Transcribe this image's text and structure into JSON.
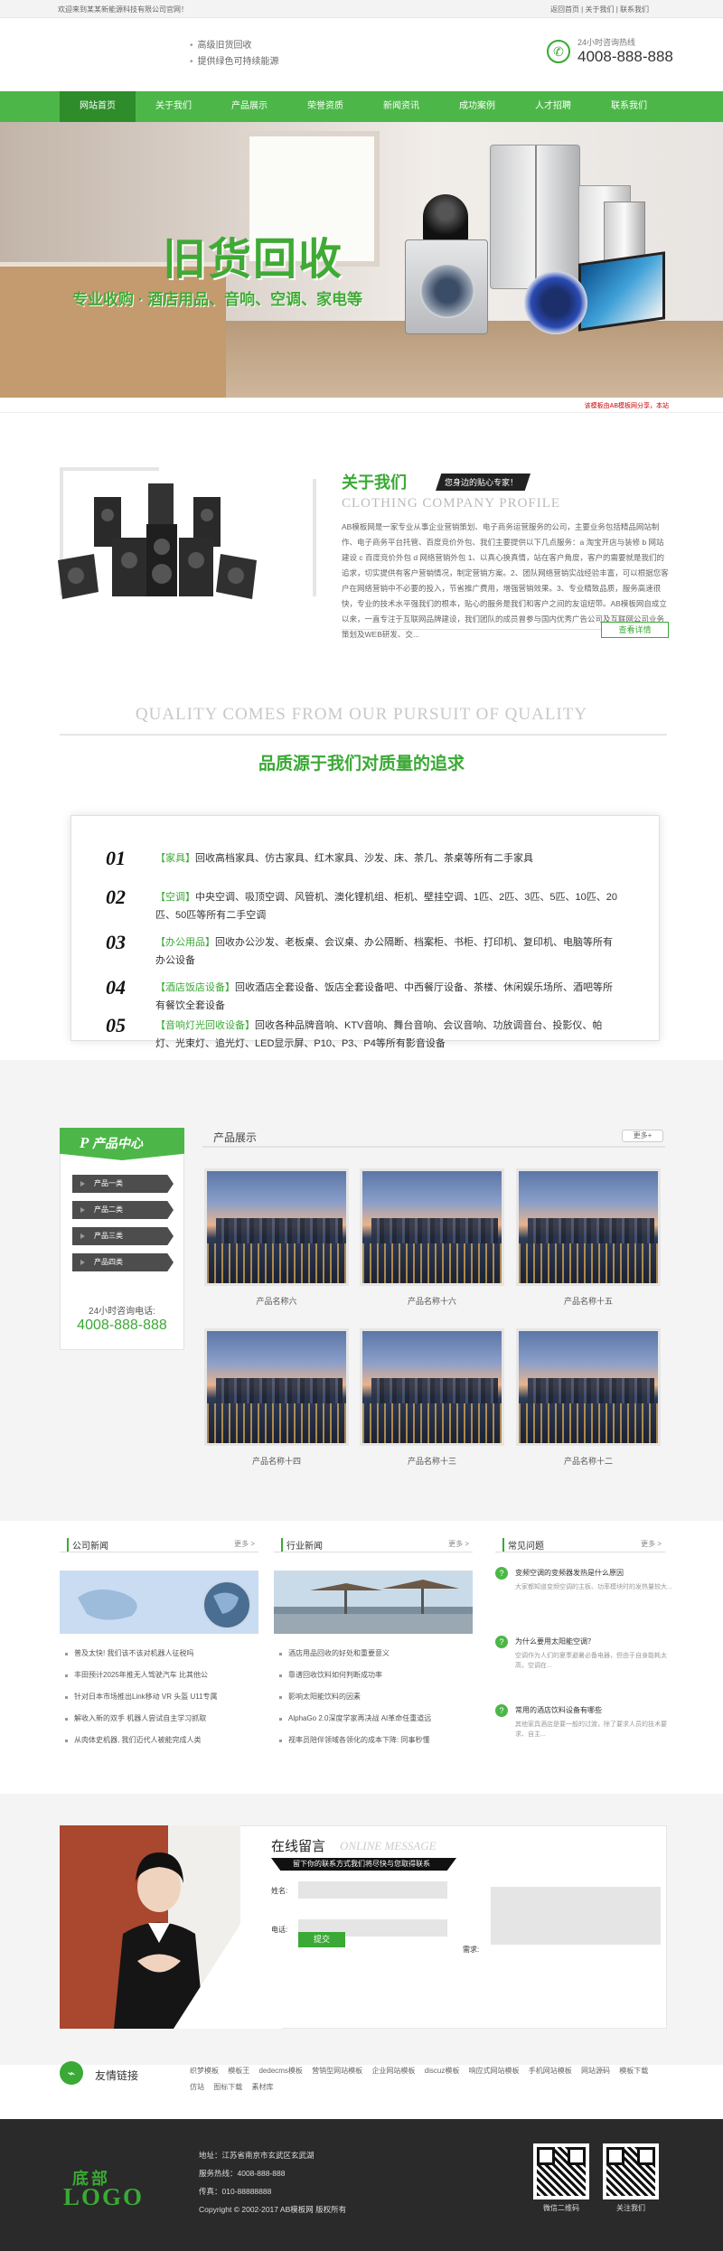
{
  "topbar": {
    "left": "欢迎来到某某新能源科技有限公司官网！",
    "right": "返回首页 | 关于我们 | 联系我们"
  },
  "header": {
    "slogan1": "高级旧货回收",
    "slogan2": "提供绿色可持续能源",
    "hotline_label": "24小时咨询热线",
    "hotline": "4008-888-888"
  },
  "nav": [
    "网站首页",
    "关于我们",
    "产品展示",
    "荣誉资质",
    "新闻资讯",
    "成功案例",
    "人才招聘",
    "联系我们"
  ],
  "banner": {
    "title": "旧货回收",
    "subtitle": "专业收购 · 酒店用品、音响、空调、家电等"
  },
  "notice": "该模板由AB模板网分享，本站",
  "about": {
    "title": "关于我们",
    "tag": "您身边的贴心专家！",
    "en": "CLOTHING COMPANY PROFILE",
    "text": "AB模板网是一家专业从事企业营销策划、电子商务运营服务的公司，主要业务包括精品网站制作、电子商务平台托管、百度竞价外包、我们主要提供以下几点服务：a 淘宝开店与装修 b 网站建设 c 百度竞价外包 d 网络营销外包 1、以真心换真情，站在客户角度，客户的需要就是我们的追求，切实提供有客户营销情况，制定营销方案。2、团队网络营销实战经验丰富，可以根据您客户在网络营销中不必要的投入，节省推广费用，增强营销效果。3、专业精致品质，服务高速很快，专业的技术水平强我们的根本，贴心的服务是我们和客户之间的友谊纽带。AB模板网自成立以来，一直专注于互联网品牌建设，我们团队的成员曾参与国内优秀广告公司及互联网公司业务策划及WEB研发、交...",
    "more": "查看详情"
  },
  "quality": {
    "en": "QUALITY COMES FROM OUR PURSUIT OF QUALITY",
    "cn": "品质源于我们对质量的追求",
    "items": [
      {
        "num": "01",
        "key": "【家具】",
        "text": "回收高档家具、仿古家具、红木家具、沙发、床、茶几、茶桌等所有二手家具"
      },
      {
        "num": "02",
        "key": "【空调】",
        "text": "中央空调、吸顶空调、风管机、澳化锂机组、柜机、壁挂空调、1匹、2匹、3匹、5匹、10匹、20匹、50匹等所有二手空调"
      },
      {
        "num": "03",
        "key": "【办公用品】",
        "text": "回收办公沙发、老板桌、会议桌、办公隔断、档案柜、书柜、打印机、复印机、电脑等所有办公设备"
      },
      {
        "num": "04",
        "key": "【酒店饭店设备】",
        "text": "回收酒店全套设备、饭店全套设备吧、中西餐厅设备、茶楼、休闲娱乐场所、酒吧等所有餐饮全套设备"
      },
      {
        "num": "05",
        "key": "【音响灯光回收设备】",
        "text": "回收各种品牌音响、KTV音响、舞台音响、会议音响、功放调音台、投影仪、帕灯、光束灯、追光灯、LED显示屏、P10、P3、P4等所有影音设备"
      }
    ]
  },
  "product_center": {
    "title": "产品中心",
    "cats": [
      "产品一类",
      "产品二类",
      "产品三类",
      "产品四类"
    ],
    "tel_label": "24小时咨询电话:",
    "tel": "4008-888-888"
  },
  "products": {
    "title": "产品展示",
    "more": "更多+",
    "items": [
      "产品名称六",
      "产品名称十六",
      "产品名称十五",
      "产品名称十四",
      "产品名称十三",
      "产品名称十二"
    ]
  },
  "news": [
    {
      "title": "公司新闻",
      "more": "更多 >",
      "items": [
        "普及太快! 我们该不该对机器人征税吗",
        "丰田预计2025年推无人驾驶汽车 比其他公",
        "针对日本市场推出Link移动 VR 头盔 U11专属",
        "解收入新的双手 机器人尝试自主学习抓取",
        "从肉体史机器, 我们迈代人被能完成人类"
      ]
    },
    {
      "title": "行业新闻",
      "more": "更多 >",
      "items": [
        "酒店用品回收的好处和重要意义",
        "靠谱回收饮料如何判断成功率",
        "影响太阳能饮料的因素",
        "AlphaGo 2.0深度学家再决战 AI革命任重道远",
        "视率员陪伴领域各领化的成本下降: 同事秒懂"
      ]
    },
    {
      "title": "常见问题",
      "more": "更多 >",
      "faqs": [
        {
          "q": "变频空调的变频器发热是什么原因",
          "a": "大家都知道变频空调的主板、功率模块时的发热量较大..."
        },
        {
          "q": "为什么要用太阳能空调？",
          "a": "空调作为人们的夏季避暑必备电器，但由于自身能耗太高，空调在..."
        },
        {
          "q": "常用的酒店饮料设备有哪些",
          "a": "其他家具酒店是要一般的过渡，除了要求人员的技术要求、自主..."
        }
      ]
    }
  ],
  "message": {
    "title": "在线留言",
    "en": "ONLINE MESSAGE",
    "bar": "留下你的联系方式我们将尽快与您取得联系",
    "name_label": "姓名:",
    "phone_label": "电话:",
    "need_label": "需求:",
    "submit": "提交"
  },
  "links": {
    "title": "友情链接",
    "items": [
      "织梦模板",
      "模板王",
      "dedecms模板",
      "营销型网站模板",
      "企业网站模板",
      "discuz模板",
      "响应式网站模板",
      "手机网站模板",
      "网站源码",
      "模板下载",
      "仿站",
      "图标下载",
      "素材库"
    ]
  },
  "footer": {
    "logo_cn": "底部",
    "logo_en": "LOGO",
    "address": "地址：江苏省南京市玄武区玄武湖",
    "service": "服务热线：4008-888-888",
    "fax": "传真：010-88888888",
    "copyright": "Copyright © 2002-2017 AB模板网 版权所有",
    "qr1": "微信二维码",
    "qr2": "关注我们"
  },
  "colors": {
    "accent": "#4cb748",
    "dark": "#2a2a2a"
  }
}
